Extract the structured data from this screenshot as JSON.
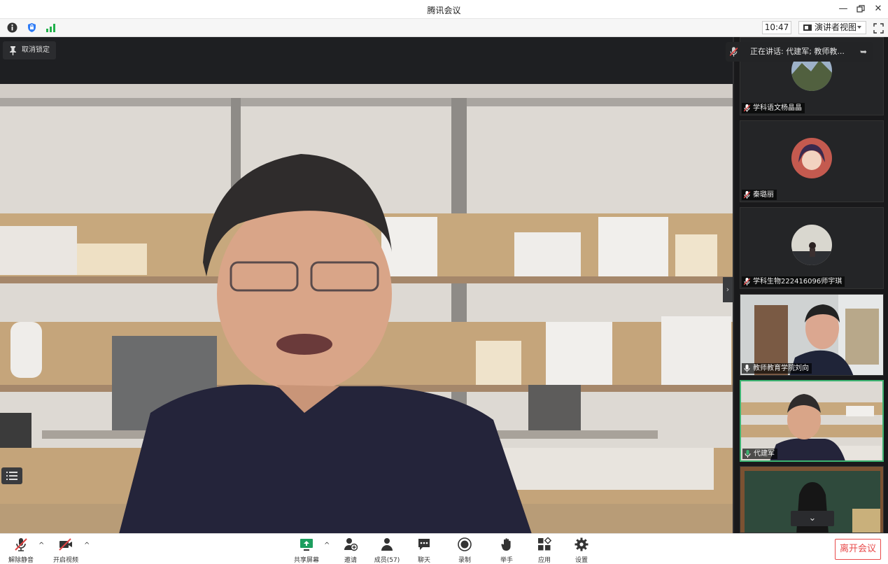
{
  "window": {
    "title": "腾讯会议"
  },
  "toolbar": {
    "time": "10:47",
    "view_mode": "演讲者视图"
  },
  "main": {
    "unpin_label": "取消锁定",
    "speaker_name": "代建军"
  },
  "speaking": {
    "text": "正在讲话: 代建军; 教师教..."
  },
  "sidebar": {
    "tiles": [
      {
        "name": "学科语文杨晶晶",
        "mic": "muted"
      },
      {
        "name": "秦璐丽",
        "mic": "muted"
      },
      {
        "name": "学科生物222416096师宇琪",
        "mic": "muted"
      },
      {
        "name": "教师教育学院刘向",
        "mic": "on"
      },
      {
        "name": "代建军",
        "mic": "speaking"
      },
      {
        "name": "",
        "mic": "on"
      }
    ]
  },
  "bottom": {
    "unmute": "解除静音",
    "start_video": "开启视频",
    "share_screen": "共享屏幕",
    "invite": "邀请",
    "members": "成员(57)",
    "chat": "聊天",
    "record": "录制",
    "raise_hand": "举手",
    "apps": "应用",
    "settings": "设置",
    "leave": "离开会议"
  },
  "colors": {
    "leave": "#e84a4a",
    "speaking": "#3cb371",
    "muted": "#e04343"
  }
}
